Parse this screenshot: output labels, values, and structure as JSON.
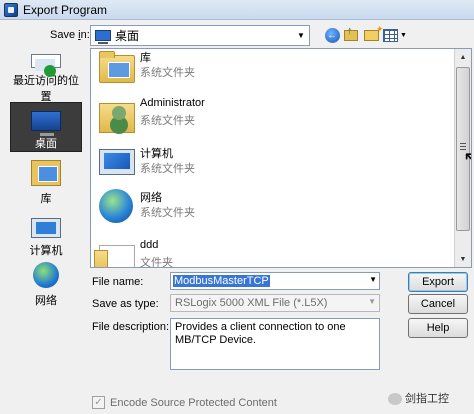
{
  "window": {
    "title": "Export Program"
  },
  "save_in": {
    "label_prefix": "Save ",
    "label_underlined": "i",
    "label_suffix": "n:",
    "current": "桌面"
  },
  "places": [
    {
      "label": "最近访问的位置",
      "icon": "recent-places-icon"
    },
    {
      "label": "桌面",
      "icon": "desktop-icon",
      "selected": true
    },
    {
      "label": "库",
      "icon": "library-icon"
    },
    {
      "label": "计算机",
      "icon": "computer-icon"
    },
    {
      "label": "网络",
      "icon": "network-icon"
    }
  ],
  "files": [
    {
      "name": "库",
      "type": "系统文件夹",
      "icon": "library-folder-icon"
    },
    {
      "name": "Administrator",
      "type": "系统文件夹",
      "icon": "user-folder-icon"
    },
    {
      "name": "计算机",
      "type": "系统文件夹",
      "icon": "computer-icon"
    },
    {
      "name": "网络",
      "type": "系统文件夹",
      "icon": "network-icon"
    },
    {
      "name": "ddd",
      "type": "文件夹",
      "icon": "folder-icon"
    }
  ],
  "form": {
    "filename_label": "File name:",
    "filename_value": "ModbusMasterTCP",
    "savetype_label": "Save as type:",
    "savetype_value": "RSLogix 5000 XML File (*.L5X)",
    "desc_label": "File description:",
    "desc_value": "Provides a client connection to one MB/TCP Device."
  },
  "buttons": {
    "export": "Export",
    "cancel": "Cancel",
    "help": "Help"
  },
  "checkbox": {
    "label": "Encode Source Protected Content",
    "checked": true
  },
  "watermark": {
    "text": "剑指工控"
  }
}
